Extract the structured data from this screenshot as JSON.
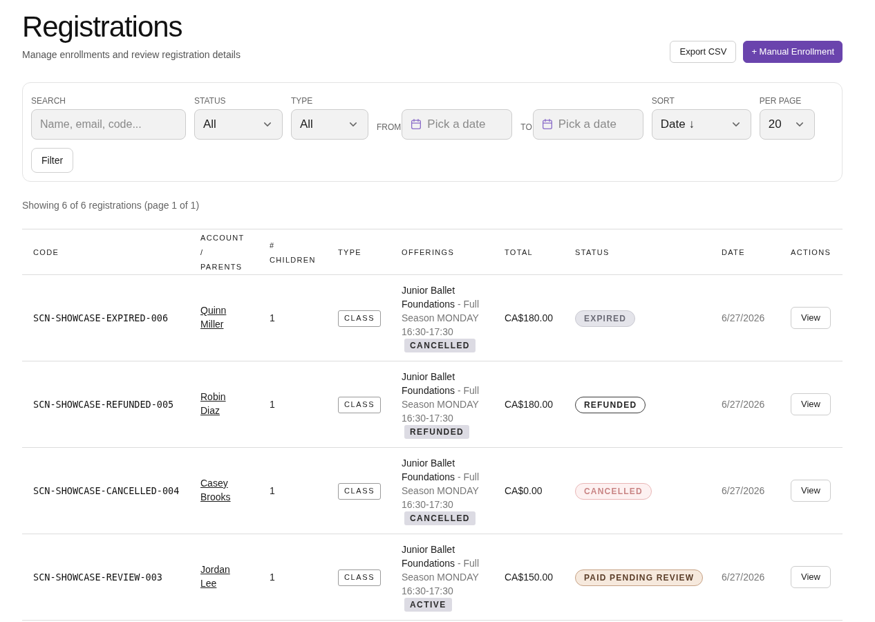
{
  "header": {
    "title": "Registrations",
    "subtitle": "Manage enrollments and review registration details",
    "buttons": [
      {
        "label": "Export CSV",
        "kind": "secondary"
      },
      {
        "label": "+ Manual Enrollment",
        "kind": "primary"
      }
    ]
  },
  "filters": {
    "fields": [
      {
        "kind": "search",
        "label": "SEARCH",
        "placeholder": "Name, email, code..."
      },
      {
        "kind": "select",
        "label": "STATUS",
        "value": "All"
      },
      {
        "kind": "select",
        "label": "TYPE",
        "value": "All"
      },
      {
        "kind": "date",
        "label": "FROM",
        "placeholder": "Pick a date"
      },
      {
        "kind": "date",
        "label": "TO",
        "placeholder": "Pick a date"
      },
      {
        "kind": "select",
        "label": "SORT",
        "value": "Date ↓"
      },
      {
        "kind": "select",
        "label": "PER PAGE",
        "value": "20"
      }
    ],
    "button": "Filter"
  },
  "summary": "Showing 6 of 6 registrations (page 1 of 1)",
  "table": {
    "columns": [
      "CODE",
      "ACCOUNT / PARENTS",
      "# CHILDREN",
      "TYPE",
      "OFFERINGS",
      "TOTAL",
      "STATUS",
      "DATE",
      "ACTIONS"
    ],
    "rows": [
      {
        "code": "SCN-SHOWCASE-EXPIRED-006",
        "account": "Quinn Miller",
        "children": "1",
        "type": "CLASS",
        "offering": {
          "name": "Junior Ballet Foundations",
          "detail": "- Full Season MONDAY 16:30-17:30",
          "status": "CANCELLED"
        },
        "total": "CA$180.00",
        "status": {
          "label": "EXPIRED",
          "kind": "expired"
        },
        "date": "6/27/2026",
        "action": "View"
      },
      {
        "code": "SCN-SHOWCASE-REFUNDED-005",
        "account": "Robin Diaz",
        "children": "1",
        "type": "CLASS",
        "offering": {
          "name": "Junior Ballet Foundations",
          "detail": "- Full Season MONDAY 16:30-17:30",
          "status": "REFUNDED"
        },
        "total": "CA$180.00",
        "status": {
          "label": "REFUNDED",
          "kind": "refunded"
        },
        "date": "6/27/2026",
        "action": "View"
      },
      {
        "code": "SCN-SHOWCASE-CANCELLED-004",
        "account": "Casey Brooks",
        "children": "1",
        "type": "CLASS",
        "offering": {
          "name": "Junior Ballet Foundations",
          "detail": "- Full Season MONDAY 16:30-17:30",
          "status": "CANCELLED"
        },
        "total": "CA$0.00",
        "status": {
          "label": "CANCELLED",
          "kind": "cancelled"
        },
        "date": "6/27/2026",
        "action": "View"
      },
      {
        "code": "SCN-SHOWCASE-REVIEW-003",
        "account": "Jordan Lee",
        "children": "1",
        "type": "CLASS",
        "offering": {
          "name": "Junior Ballet Foundations",
          "detail": "- Full Season MONDAY 16:30-17:30",
          "status": "ACTIVE"
        },
        "total": "CA$150.00",
        "status": {
          "label": "PAID PENDING REVIEW",
          "kind": "paid_pending_review"
        },
        "date": "6/27/2026",
        "action": "View"
      }
    ]
  }
}
